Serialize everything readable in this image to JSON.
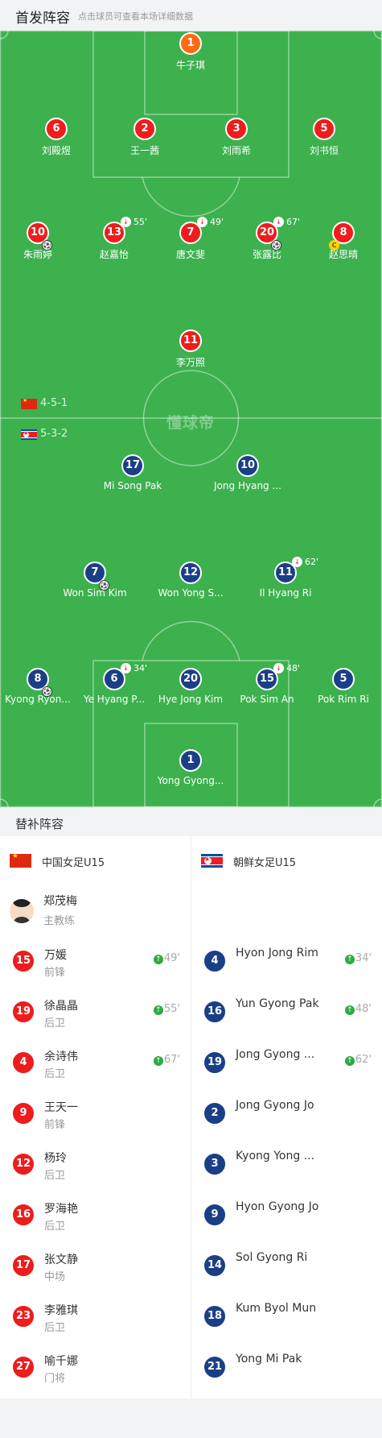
{
  "header": {
    "title": "首发阵容",
    "subtitle": "点击球员可查看本场详细数据"
  },
  "pitch": {
    "watermark": "懂球帝",
    "china_formation": "4-5-1",
    "korea_formation": "5-3-2",
    "china": [
      {
        "num": "1",
        "name": "牛子琪"
      },
      {
        "num": "6",
        "name": "刘殿煜"
      },
      {
        "num": "2",
        "name": "王一茜"
      },
      {
        "num": "3",
        "name": "刘雨希"
      },
      {
        "num": "5",
        "name": "刘书恒"
      },
      {
        "num": "10",
        "name": "朱雨婷"
      },
      {
        "num": "13",
        "name": "赵嘉怡",
        "sub": "55'"
      },
      {
        "num": "7",
        "name": "唐文斐",
        "sub": "49'"
      },
      {
        "num": "20",
        "name": "张露比",
        "sub": "67'"
      },
      {
        "num": "8",
        "name": "赵思晴"
      },
      {
        "num": "11",
        "name": "李万照"
      }
    ],
    "korea": [
      {
        "num": "17",
        "name": "Mi Song Pak"
      },
      {
        "num": "10",
        "name": "Jong Hyang ..."
      },
      {
        "num": "7",
        "name": "Won Sim Kim"
      },
      {
        "num": "12",
        "name": "Won Yong S..."
      },
      {
        "num": "11",
        "name": "Il Hyang Ri",
        "sub": "62'"
      },
      {
        "num": "8",
        "name": "Kyong Ryon..."
      },
      {
        "num": "6",
        "name": "Ye Hyang P...",
        "sub": "34'"
      },
      {
        "num": "20",
        "name": "Hye Jong Kim"
      },
      {
        "num": "15",
        "name": "Pok Sim An",
        "sub": "48'"
      },
      {
        "num": "5",
        "name": "Pok Rim Ri"
      },
      {
        "num": "1",
        "name": "Yong Gyong..."
      }
    ]
  },
  "subs": {
    "title": "替补阵容",
    "china_team": "中国女足U15",
    "korea_team": "朝鲜女足U15",
    "coach": {
      "name": "郑茂梅",
      "role": "主教练"
    },
    "china": [
      {
        "num": "15",
        "name": "万媛",
        "role": "前锋",
        "in": "49'"
      },
      {
        "num": "19",
        "name": "徐晶晶",
        "role": "后卫",
        "in": "55'"
      },
      {
        "num": "4",
        "name": "余诗伟",
        "role": "后卫",
        "in": "67'"
      },
      {
        "num": "9",
        "name": "王天一",
        "role": "前锋"
      },
      {
        "num": "12",
        "name": "杨玲",
        "role": "后卫"
      },
      {
        "num": "16",
        "name": "罗海艳",
        "role": "后卫"
      },
      {
        "num": "17",
        "name": "张文静",
        "role": "中场"
      },
      {
        "num": "23",
        "name": "李雅琪",
        "role": "后卫"
      },
      {
        "num": "27",
        "name": "喻千娜",
        "role": "门将"
      }
    ],
    "korea": [
      {
        "num": "4",
        "name": "Hyon Jong Rim",
        "in": "34'"
      },
      {
        "num": "16",
        "name": "Yun Gyong Pak",
        "in": "48'"
      },
      {
        "num": "19",
        "name": "Jong Gyong ...",
        "in": "62'"
      },
      {
        "num": "2",
        "name": "Jong Gyong Jo"
      },
      {
        "num": "3",
        "name": "Kyong Yong ..."
      },
      {
        "num": "9",
        "name": "Hyon Gyong Jo"
      },
      {
        "num": "14",
        "name": "Sol Gyong Ri"
      },
      {
        "num": "18",
        "name": "Kum Byol Mun"
      },
      {
        "num": "21",
        "name": "Yong Mi Pak"
      }
    ]
  }
}
